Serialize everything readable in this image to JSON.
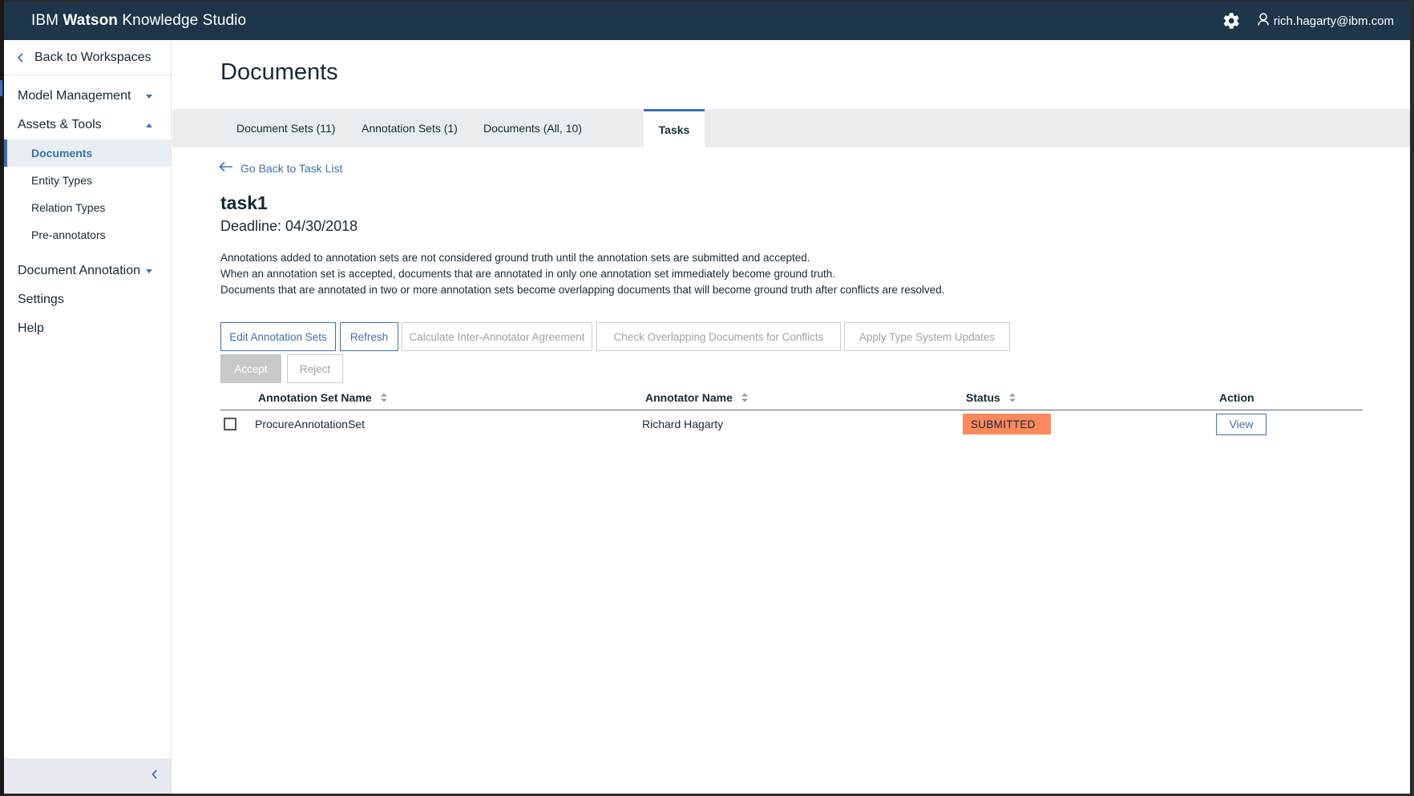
{
  "header": {
    "brand_prefix": "IBM",
    "brand_bold": "Watson",
    "brand_suffix": "Knowledge Studio",
    "user_email": "rich.hagarty@ibm.com",
    "icons": {
      "settings": "gear-icon",
      "user": "user-icon"
    }
  },
  "sidebar": {
    "back_label": "Back to Workspaces",
    "groups": [
      {
        "label": "Model Management",
        "expanded": false
      },
      {
        "label": "Assets & Tools",
        "expanded": true,
        "items": [
          {
            "label": "Documents",
            "active": true
          },
          {
            "label": "Entity Types",
            "active": false
          },
          {
            "label": "Relation Types",
            "active": false
          },
          {
            "label": "Pre-annotators",
            "active": false
          }
        ]
      },
      {
        "label": "Document Annotation",
        "expanded": false
      }
    ],
    "singles": [
      "Settings",
      "Help"
    ]
  },
  "main": {
    "title": "Documents",
    "tabs": [
      {
        "label": "Document Sets (11)",
        "active": false
      },
      {
        "label": "Annotation Sets (1)",
        "active": false
      },
      {
        "label": "Documents (All, 10)",
        "active": false
      },
      {
        "label": "Tasks",
        "active": true
      }
    ],
    "back_link": "Go Back to Task List",
    "task_name": "task1",
    "deadline": "Deadline: 04/30/2018",
    "description": [
      "Annotations added to annotation sets are not considered ground truth until the annotation sets are submitted and accepted.",
      "When an annotation set is accepted, documents that are annotated in only one annotation set immediately become ground truth.",
      "Documents that are annotated in two or more annotation sets become overlapping documents that will become ground truth after conflicts are resolved."
    ],
    "buttons": {
      "edit_sets": "Edit Annotation Sets",
      "refresh": "Refresh",
      "calc_iaa": "Calculate Inter-Annotator Agreement",
      "check_overlap": "Check Overlapping Documents for Conflicts",
      "apply_type": "Apply Type System Updates",
      "accept": "Accept",
      "reject": "Reject"
    },
    "table": {
      "columns": [
        "Annotation Set Name",
        "Annotator Name",
        "Status",
        "Action"
      ],
      "rows": [
        {
          "set_name": "ProcureAnnotationSet",
          "annotator": "Richard Hagarty",
          "status": "SUBMITTED",
          "action": "View"
        }
      ]
    }
  },
  "colors": {
    "header_bg": "#1d3649",
    "accent": "#3d70b2",
    "status_submitted": "#fa8a5e",
    "tabs_band": "#e9ecee"
  }
}
